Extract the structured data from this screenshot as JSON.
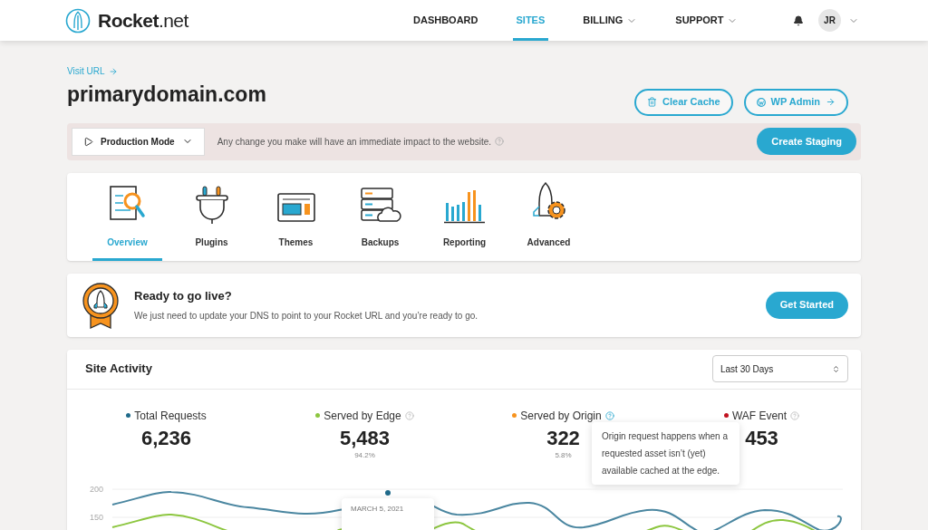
{
  "header": {
    "logo_name": "Rocket",
    "logo_suffix": ".net",
    "nav": [
      {
        "label": "DASHBOARD",
        "selected": false,
        "dropdown": false
      },
      {
        "label": "SITES",
        "selected": true,
        "dropdown": false
      },
      {
        "label": "BILLING",
        "selected": false,
        "dropdown": true
      },
      {
        "label": "SUPPORT",
        "selected": false,
        "dropdown": true
      }
    ],
    "avatar": "JR"
  },
  "site": {
    "visit_link": "Visit URL",
    "domain": "primarydomain.com",
    "clear_cache": "Clear Cache",
    "wp_admin": "WP Admin"
  },
  "mode_bar": {
    "mode": "Production Mode",
    "message": "Any change you make will have an immediate impact to the website.",
    "action": "Create Staging"
  },
  "tabs": [
    {
      "label": "Overview",
      "kind": "overview",
      "selected": true
    },
    {
      "label": "Plugins",
      "kind": "plugins",
      "selected": false
    },
    {
      "label": "Themes",
      "kind": "themes",
      "selected": false
    },
    {
      "label": "Backups",
      "kind": "backups",
      "selected": false
    },
    {
      "label": "Reporting",
      "kind": "reporting",
      "selected": false
    },
    {
      "label": "Advanced",
      "kind": "advanced",
      "selected": false
    }
  ],
  "go_live": {
    "title": "Ready to go live?",
    "text": "We just need to update your DNS to point to your Rocket URL and you’re ready to go.",
    "button": "Get Started"
  },
  "activity": {
    "title": "Site Activity",
    "range": "Last 30 Days",
    "stats": [
      {
        "label": "Total Requests",
        "value": "6,236",
        "color": "#1f6a8a",
        "help": false
      },
      {
        "label": "Served by Edge",
        "value": "5,483",
        "percent": "94.2%",
        "color": "#8cc63f",
        "help": true
      },
      {
        "label": "Served by Origin",
        "value": "322",
        "percent": "5.8%",
        "color": "#f7931e",
        "help": true
      },
      {
        "label": "WAF Event",
        "value": "453",
        "color": "#c1121f",
        "help": true
      }
    ],
    "tooltip": "Origin request happens when a requested asset isn’t (yet) available cached at the edge.",
    "chart": {
      "y_labels": [
        "200",
        "150"
      ],
      "tooltip": "MARCH 5, 2021"
    }
  }
}
